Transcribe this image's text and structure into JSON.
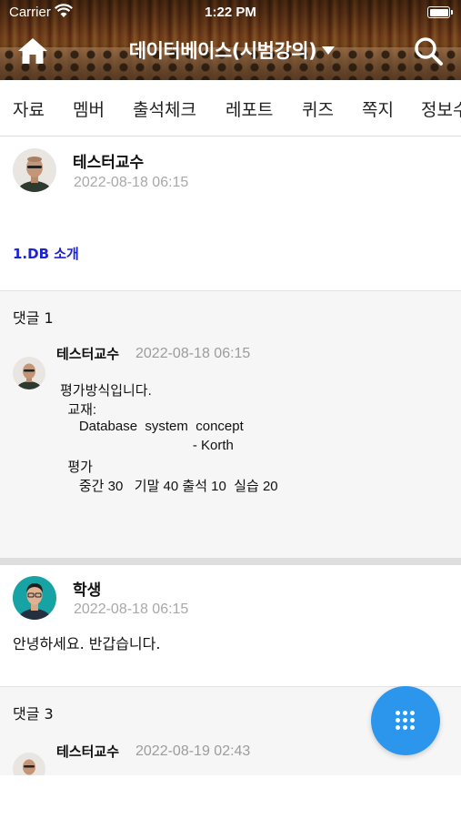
{
  "status_bar": {
    "carrier": "Carrier",
    "time": "1:22 PM",
    "wifi_icon": "wifi-icon",
    "battery_icon": "battery-full-icon"
  },
  "header": {
    "home_icon": "home-icon",
    "title": "데이터베이스(시범강의)",
    "dropdown_icon": "caret-down-icon",
    "search_icon": "search-icon"
  },
  "tabs": [
    "자료",
    "멤버",
    "출석체크",
    "레포트",
    "퀴즈",
    "쪽지",
    "정보수"
  ],
  "post": {
    "author": "테스터교수",
    "date": "2022-08-18 06:15",
    "link_text": "1.DB 소개"
  },
  "comment_group_1": {
    "count_label": "댓글 1",
    "author": "테스터교수",
    "date": "2022-08-18 06:15",
    "lines": [
      "평가방식입니다.",
      "  교재:",
      "     Database  system  concept",
      "                                   - Korth",
      "  평가",
      "     중간 30   기말 40 출석 10  실습 20"
    ]
  },
  "reply": {
    "author": "학생",
    "date": "2022-08-18 06:15",
    "text": "안녕하세요. 반갑습니다."
  },
  "comment_group_3": {
    "count_label": "댓글 3",
    "author": "테스터교수",
    "date": "2022-08-19 02:43"
  },
  "fab": {
    "icon": "grid-menu-icon",
    "color": "#2c96ec"
  },
  "colors": {
    "link": "#1a23d6",
    "date_gray": "#a8a8a8",
    "accent": "#2c96ec"
  }
}
